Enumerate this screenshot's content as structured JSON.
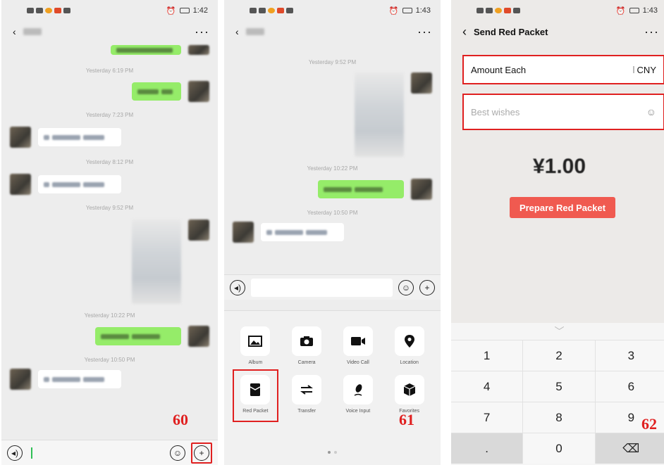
{
  "panel1": {
    "status_time": "1:42",
    "timestamps": [
      "Yesterday 6:19 PM",
      "Yesterday 7:23 PM",
      "Yesterday 8:12 PM",
      "Yesterday 9:52 PM",
      "Yesterday 10:22 PM",
      "Yesterday 10:50 PM"
    ],
    "step_label": "60"
  },
  "panel2": {
    "status_time": "1:43",
    "timestamps": [
      "Yesterday 9:52 PM",
      "Yesterday 10:22 PM",
      "Yesterday 10:50 PM"
    ],
    "tools": [
      {
        "label": "Album",
        "icon": "image-icon"
      },
      {
        "label": "Camera",
        "icon": "camera-icon"
      },
      {
        "label": "Video Call",
        "icon": "video-call-icon"
      },
      {
        "label": "Location",
        "icon": "location-pin-icon"
      },
      {
        "label": "Red Packet",
        "icon": "red-packet-icon"
      },
      {
        "label": "Transfer",
        "icon": "transfer-icon"
      },
      {
        "label": "Voice Input",
        "icon": "microphone-icon"
      },
      {
        "label": "Favorites",
        "icon": "cube-icon"
      }
    ],
    "step_label": "61"
  },
  "panel3": {
    "status_time": "1:43",
    "title": "Send Red Packet",
    "amount_label": "Amount Each",
    "currency": "CNY",
    "wishes_placeholder": "Best wishes",
    "amount_display": "¥1.00",
    "button_label": "Prepare Red Packet",
    "keys": [
      "1",
      "2",
      "3",
      "4",
      "5",
      "6",
      "7",
      "8",
      "9",
      ".",
      "0",
      "⌫"
    ],
    "step_label": "62"
  },
  "colors": {
    "highlight": "#e02020",
    "bubble_green": "#95ec69",
    "red_packet_button": "#f05a50"
  }
}
